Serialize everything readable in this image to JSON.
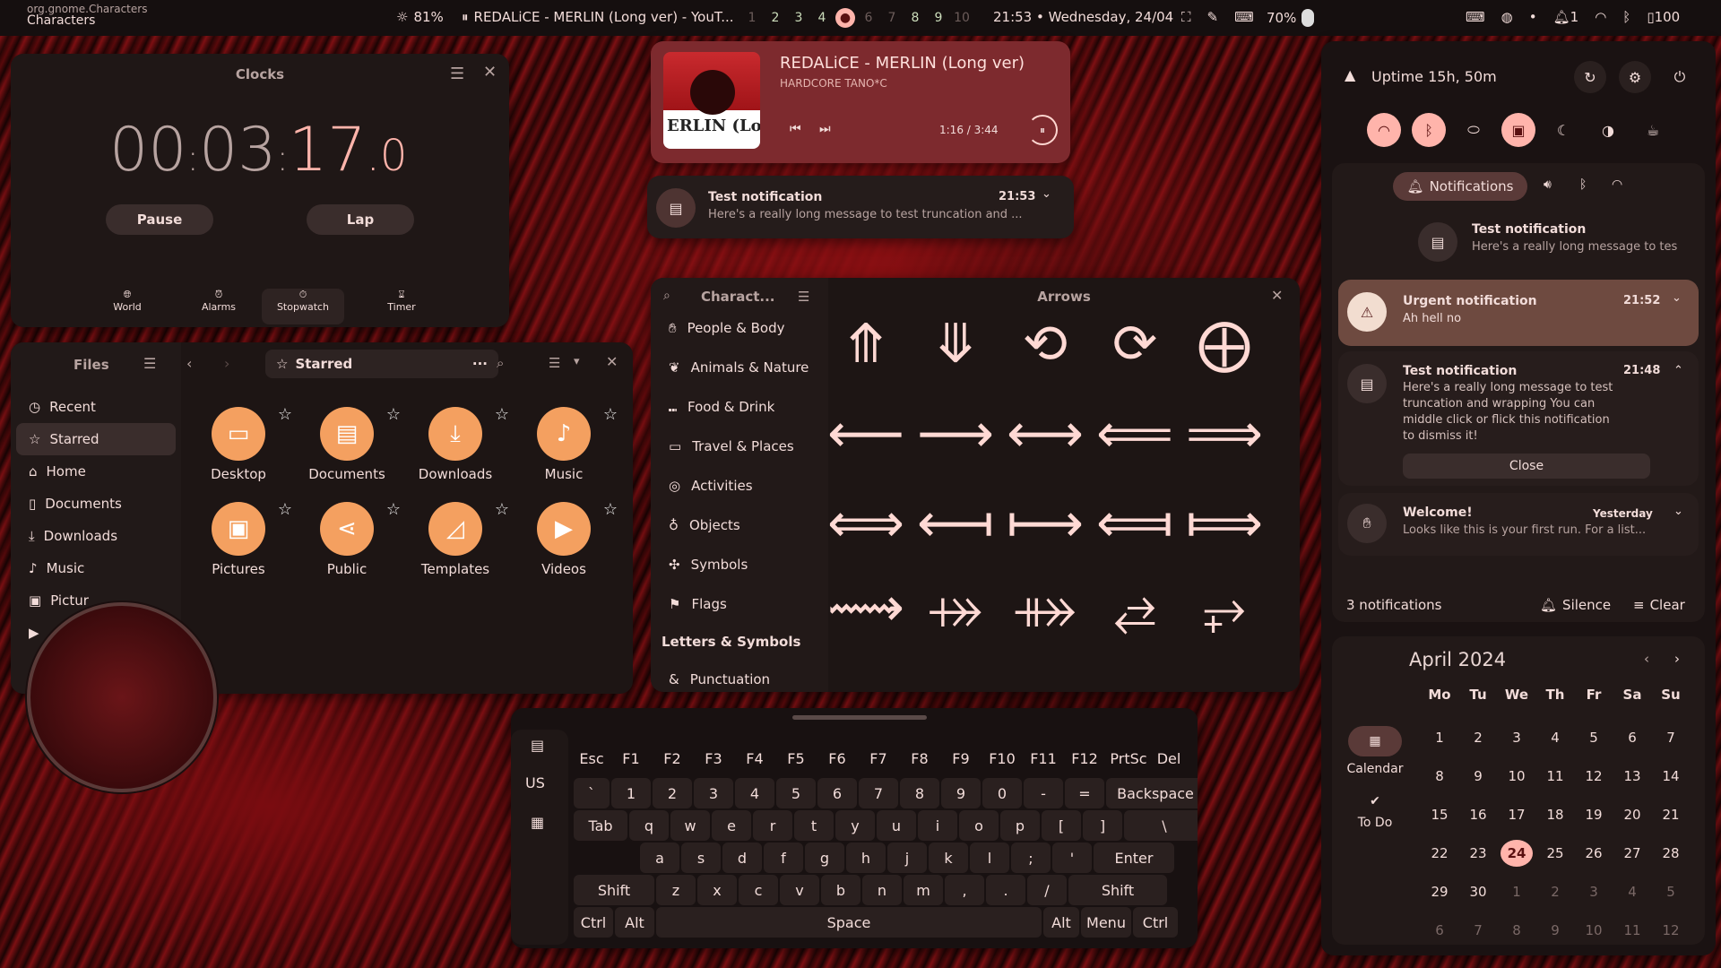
{
  "topbar": {
    "app_id": "org.gnome.Characters",
    "app_name": "Characters",
    "brightness": "81%",
    "media_title": "REDALiCE - MERLIN (Long ver) - YouT...",
    "workspaces": [
      "1",
      "2",
      "3",
      "4",
      "",
      "6",
      "7",
      "8",
      "9",
      "10"
    ],
    "clock": "21:53 • Wednesday, 24/04",
    "battery": "70%",
    "notif_count": "1",
    "volume_pct": "100"
  },
  "clocks": {
    "title": "Clocks",
    "h": "00",
    "m": "03",
    "s": "17",
    "cs": "0",
    "pause": "Pause",
    "lap": "Lap",
    "tabs": [
      "World",
      "Alarms",
      "Stopwatch",
      "Timer"
    ]
  },
  "media": {
    "title": "REDALiCE - MERLIN (Long ver)",
    "artist": "HARDCORE TANO*C",
    "time": "1:16 / 3:44",
    "cover_text": "ERLIN (Lon"
  },
  "popup": {
    "title": "Test notification",
    "time": "21:53",
    "body": "Here's a really long message to test truncation and ..."
  },
  "files": {
    "title": "Files",
    "location": "Starred",
    "sidebar": [
      "Recent",
      "Starred",
      "Home",
      "Documents",
      "Downloads",
      "Music",
      "Pictur"
    ],
    "folders": [
      "Desktop",
      "Documents",
      "Downloads",
      "Music",
      "Pictures",
      "Public",
      "Templates",
      "Videos"
    ]
  },
  "chars": {
    "search": "Charact...",
    "title": "Arrows",
    "categories": [
      "People & Body",
      "Animals & Nature",
      "Food & Drink",
      "Travel & Places",
      "Activities",
      "Objects",
      "Symbols",
      "Flags"
    ],
    "section": "Letters & Symbols",
    "punct": "Punctuation",
    "glyphs": [
      "⤊",
      "⤋",
      "⟲",
      "⟳",
      "⨁",
      "⟵",
      "⟶",
      "⟷",
      "⟸",
      "⟹",
      "⟺",
      "⟻",
      "⟼",
      "⟽",
      "⟾",
      "⟿",
      "⤀",
      "⤁",
      "⥄",
      "⥅"
    ]
  },
  "keyboard": {
    "lang": "US",
    "rows": [
      [
        "Esc",
        "F1",
        "F2",
        "F3",
        "F4",
        "F5",
        "F6",
        "F7",
        "F8",
        "F9",
        "F10",
        "F11",
        "F12",
        "PrtSc",
        "Del"
      ],
      [
        "`",
        "1",
        "2",
        "3",
        "4",
        "5",
        "6",
        "7",
        "8",
        "9",
        "0",
        "-",
        "=",
        "Backspace"
      ],
      [
        "Tab",
        "q",
        "w",
        "e",
        "r",
        "t",
        "y",
        "u",
        "i",
        "o",
        "p",
        "[",
        "]",
        "\\"
      ],
      [
        "a",
        "s",
        "d",
        "f",
        "g",
        "h",
        "j",
        "k",
        "l",
        ";",
        "'",
        "Enter"
      ],
      [
        "Shift",
        "z",
        "x",
        "c",
        "v",
        "b",
        "n",
        "m",
        ",",
        ".",
        "/",
        "Shift"
      ],
      [
        "Ctrl",
        "Alt",
        "Space",
        "Alt",
        "Menu",
        "Ctrl"
      ]
    ]
  },
  "sidebar": {
    "uptime": "Uptime 15h, 50m",
    "notif_tab": "Notifications",
    "n1": {
      "title": "Test notification",
      "body": "Here's a really long message to tes"
    },
    "urgent": {
      "title": "Urgent notification",
      "time": "21:52",
      "body": "Ah hell no"
    },
    "n2": {
      "title": "Test notification",
      "time": "21:48",
      "body": "Here's a really long message to test truncation and wrapping You can middle click or flick this notification to dismiss it!",
      "close": "Close"
    },
    "welcome": {
      "title": "Welcome!",
      "time": "Yesterday",
      "body": "Looks like this is your first run. For a list..."
    },
    "count": "3 notifications",
    "silence": "Silence",
    "clear": "Clear"
  },
  "calendar": {
    "month": "April 2024",
    "weekdays": [
      "Mo",
      "Tu",
      "We",
      "Th",
      "Fr",
      "Sa",
      "Su"
    ],
    "days": [
      "1",
      "2",
      "3",
      "4",
      "5",
      "6",
      "7",
      "8",
      "9",
      "10",
      "11",
      "12",
      "13",
      "14",
      "15",
      "16",
      "17",
      "18",
      "19",
      "20",
      "21",
      "22",
      "23",
      "24",
      "25",
      "26",
      "27",
      "28",
      "29",
      "30",
      "1",
      "2",
      "3",
      "4",
      "5",
      "6",
      "7",
      "8",
      "9",
      "10",
      "11",
      "12"
    ],
    "today": "24",
    "calendar_label": "Calendar",
    "todo_label": "To Do"
  }
}
